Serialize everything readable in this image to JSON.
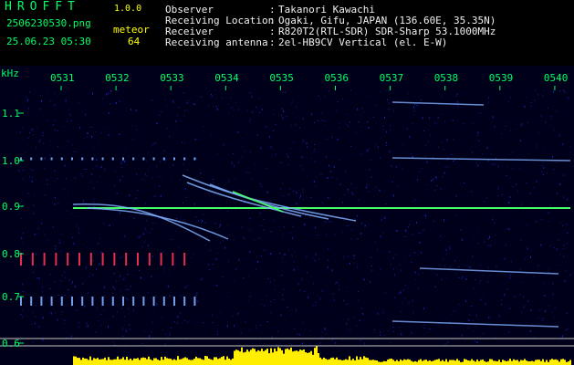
{
  "header": {
    "brand": "HROFFT",
    "version": "1.0.0",
    "filename": "2506230530.png",
    "datetime": "25.06.23 05:30",
    "meteor_label": "meteor",
    "meteor_count": "64"
  },
  "info": [
    {
      "label": "Observer",
      "sep": ":",
      "value": "Takanori Kawachi"
    },
    {
      "label": "Receiving Location",
      "sep": ":",
      "value": "Ogaki, Gifu, JAPAN (136.60E, 35.35N)"
    },
    {
      "label": "Receiver",
      "sep": ":",
      "value": "R820T2(RTL-SDR) SDR-Sharp 53.1000MHz"
    },
    {
      "label": "Receiving antenna",
      "sep": ":",
      "value": "2el-HB9CV Vertical (el. E-W)"
    }
  ],
  "spectrogram": {
    "unit_label": "kHz",
    "time_ticks": [
      "0531",
      "0532",
      "0533",
      "0534",
      "0535",
      "0536",
      "0537",
      "0538",
      "0539",
      "0540"
    ],
    "freq_ticks": [
      "1.1",
      "1.0",
      "0.9",
      "0.8",
      "0.7",
      "0.6"
    ],
    "colors": {
      "background": "#00001a",
      "noise": "#1a3cff",
      "carrier": "#44ff66",
      "echo": "#7fb0ff",
      "hot": "#ff3355",
      "level": "#ffee00",
      "text_primary": "#00ff66",
      "text_header": "#ffff00"
    }
  }
}
